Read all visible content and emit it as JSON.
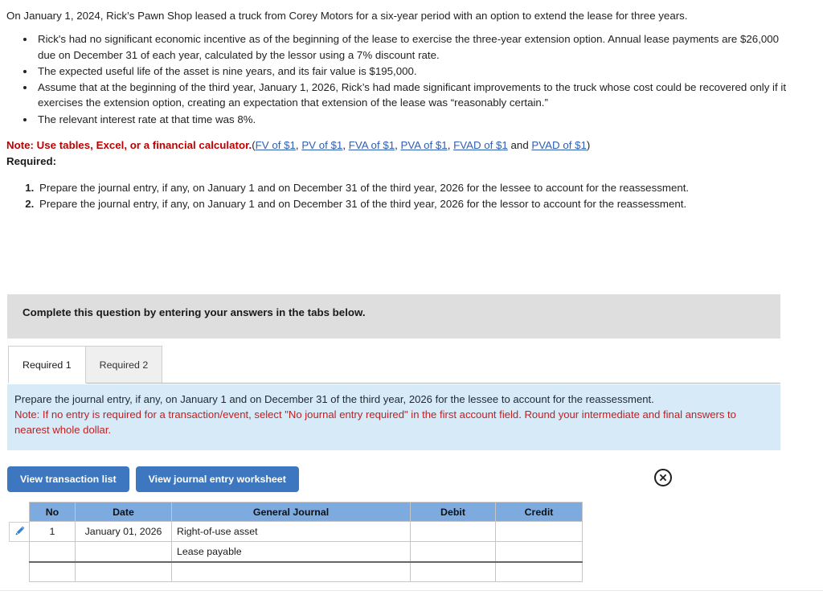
{
  "intro": {
    "paragraph": "On January 1, 2024, Rick’s Pawn Shop leased a truck from Corey Motors for a six-year period with an option to extend the lease for three years.",
    "bullets": [
      "Rick's had no significant economic incentive as of the beginning of the lease to exercise the three-year extension option. Annual lease payments are $26,000 due on December 31 of each year, calculated by the lessor using a 7% discount rate.",
      "The expected useful life of the asset is nine years, and its fair value is $195,000.",
      "Assume that at the beginning of the third year, January 1, 2026, Rick’s had made significant improvements to the truck whose cost could be recovered only if it exercises the extension option, creating an expectation that extension of the lease was “reasonably certain.”",
      "The relevant interest rate at that time was 8%."
    ]
  },
  "note": {
    "label": "Note: Use tables, Excel, or a financial calculator.",
    "open_paren": "(",
    "links": [
      "FV of $1",
      "PV of $1",
      "FVA of $1",
      "PVA of $1",
      "FVAD of $1",
      "PVAD of $1"
    ],
    "separator": ", ",
    "and_word": " and ",
    "close_paren": ")",
    "required_label": "Required:"
  },
  "requirements": [
    "Prepare the journal entry, if any, on January 1 and on December 31 of the third year, 2026 for the lessee to account for the reassessment.",
    "Prepare the journal entry, if any, on January 1 and on December 31 of the third year, 2026 for the lessor to account for the reassessment."
  ],
  "banner": {
    "text": "Complete this question by entering your answers in the tabs below."
  },
  "tabs": [
    {
      "label": "Required 1",
      "active": true
    },
    {
      "label": "Required 2",
      "active": false
    }
  ],
  "instruction_panel": {
    "line1": "Prepare the journal entry, if any, on January 1 and on December 31 of the third year, 2026 for the lessee to account for the reassessment.",
    "line2": "Note: If no entry is required for a transaction/event, select \"No journal entry required\" in the first account field. Round your intermediate and final answers to nearest whole dollar."
  },
  "toolbar": {
    "view_transaction_list": "View transaction list",
    "view_journal_entry_worksheet": "View journal entry worksheet",
    "close_icon": "close-circle-icon",
    "edit_icon": "pencil-icon"
  },
  "journal_table": {
    "headers": [
      "No",
      "Date",
      "General Journal",
      "Debit",
      "Credit"
    ],
    "rows": [
      {
        "no": "1",
        "date": "January 01, 2026",
        "account": "Right-of-use asset",
        "debit": "",
        "credit": ""
      },
      {
        "no": "",
        "date": "",
        "account": "Lease payable",
        "debit": "",
        "credit": ""
      },
      {
        "no": "",
        "date": "",
        "account": "",
        "debit": "",
        "credit": ""
      }
    ]
  },
  "colors": {
    "header_blue": "#7dabe0",
    "button_blue": "#3c77c0",
    "panel_blue": "#d6eaf8",
    "banner_grey": "#dedede",
    "note_red": "#c00000",
    "link_blue": "#2f5fb3"
  }
}
